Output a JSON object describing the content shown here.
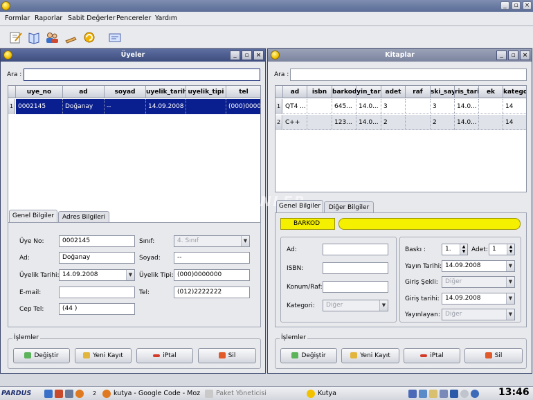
{
  "menu": {
    "items": [
      "Formlar",
      "Raporlar",
      "Sabit Değerler",
      "Pencereler",
      "Yardım"
    ]
  },
  "toolbar": {
    "icons": [
      "edit-icon",
      "book-icon",
      "users-icon",
      "pen-icon",
      "refresh-icon",
      "card-icon"
    ]
  },
  "uyeler": {
    "title": "Üyeler",
    "search_label": "Ara :",
    "search_value": "",
    "columns": [
      "uye_no",
      "ad",
      "soyad",
      "uyelik_tarihi",
      "uyelik_tipi",
      "tel"
    ],
    "rows": [
      {
        "num": "1",
        "cells": [
          "0002145",
          "Doğanay",
          "--",
          "14.09.2008",
          "",
          "(000)0000..."
        ]
      }
    ],
    "tabs": [
      "Genel Bilgiler",
      "Adres Bilgileri"
    ],
    "form": {
      "uye_no_label": "Üye No:",
      "uye_no": "0002145",
      "ad_label": "Ad:",
      "ad": "Doğanay",
      "uyelik_tarihi_label": "Üyelik Tarihi:",
      "uyelik_tarihi": "14.09.2008",
      "email_label": "E-mail:",
      "email": "",
      "cep_label": "Cep Tel:",
      "cep": "(44 )",
      "sinif_label": "Sınıf:",
      "sinif": "4. Sınıf",
      "soyad_label": "Soyad:",
      "soyad": "--",
      "uyelik_tipi_label": "Üyelik Tipi:",
      "uyelik_tipi": "(000)0000000",
      "tel_label": "Tel:",
      "tel": "(012)2222222"
    },
    "actions_legend": "İşlemler",
    "buttons": [
      "Değiştir",
      "Yeni Kayıt",
      "iPtal",
      "Sil"
    ]
  },
  "kitaplar": {
    "title": "Kitaplar",
    "search_label": "Ara :",
    "search_value": "",
    "columns": [
      "ad",
      "isbn",
      "barkod",
      "yin_tar",
      "adet",
      "raf",
      "ski_say",
      "ris_tari",
      "ek",
      "kategor"
    ],
    "rows": [
      {
        "num": "1",
        "cells": [
          "QT4 ...",
          "",
          "645...",
          "14.0...",
          "3",
          "",
          "3",
          "14.0...",
          "",
          "14"
        ]
      },
      {
        "num": "2",
        "cells": [
          "C++",
          "",
          "123...",
          "14.0...",
          "2",
          "",
          "2",
          "14.0...",
          "",
          "14"
        ]
      }
    ],
    "tabs": [
      "Genel Bilgiler",
      "Diğer Bilgiler"
    ],
    "barkod_label": "BARKOD",
    "barkod_value": "",
    "form": {
      "ad_label": "Ad:",
      "ad": "",
      "isbn_label": "ISBN:",
      "isbn": "",
      "konum_label": "Konum/Raf:",
      "konum": "",
      "kategori_label": "Kategori:",
      "kategori": "Diğer",
      "baski_label": "Baskı :",
      "baski": "1.",
      "adet_label": "Adet:",
      "adet": "1",
      "yayin_tarihi_label": "Yayın Tarihi:",
      "yayin_tarihi": "14.09.2008",
      "giris_sekli_label": "Giriş Şekli:",
      "giris_sekli": "Diğer",
      "giris_tarihi_label": "Giriş tarihi:",
      "giris_tarihi": "14.09.2008",
      "yayinlayan_label": "Yayınlayan:",
      "yayinlayan": "Diğer"
    },
    "actions_legend": "İşlemler",
    "buttons": [
      "Değiştir",
      "Yeni Kayıt",
      "iPtal",
      "Sil"
    ]
  },
  "watermark": "GEZGİNLER",
  "taskbar": {
    "start": "PARDUS",
    "tasks": [
      "kutya - Google Code - Moz",
      "Paket Yöneticisi",
      "Kutya"
    ],
    "clock": "13:46",
    "desktop_num": "2"
  },
  "colors": {
    "title_active": "#3e4d7e",
    "selection": "#0a1f8f",
    "barkod": "#f5f000"
  }
}
